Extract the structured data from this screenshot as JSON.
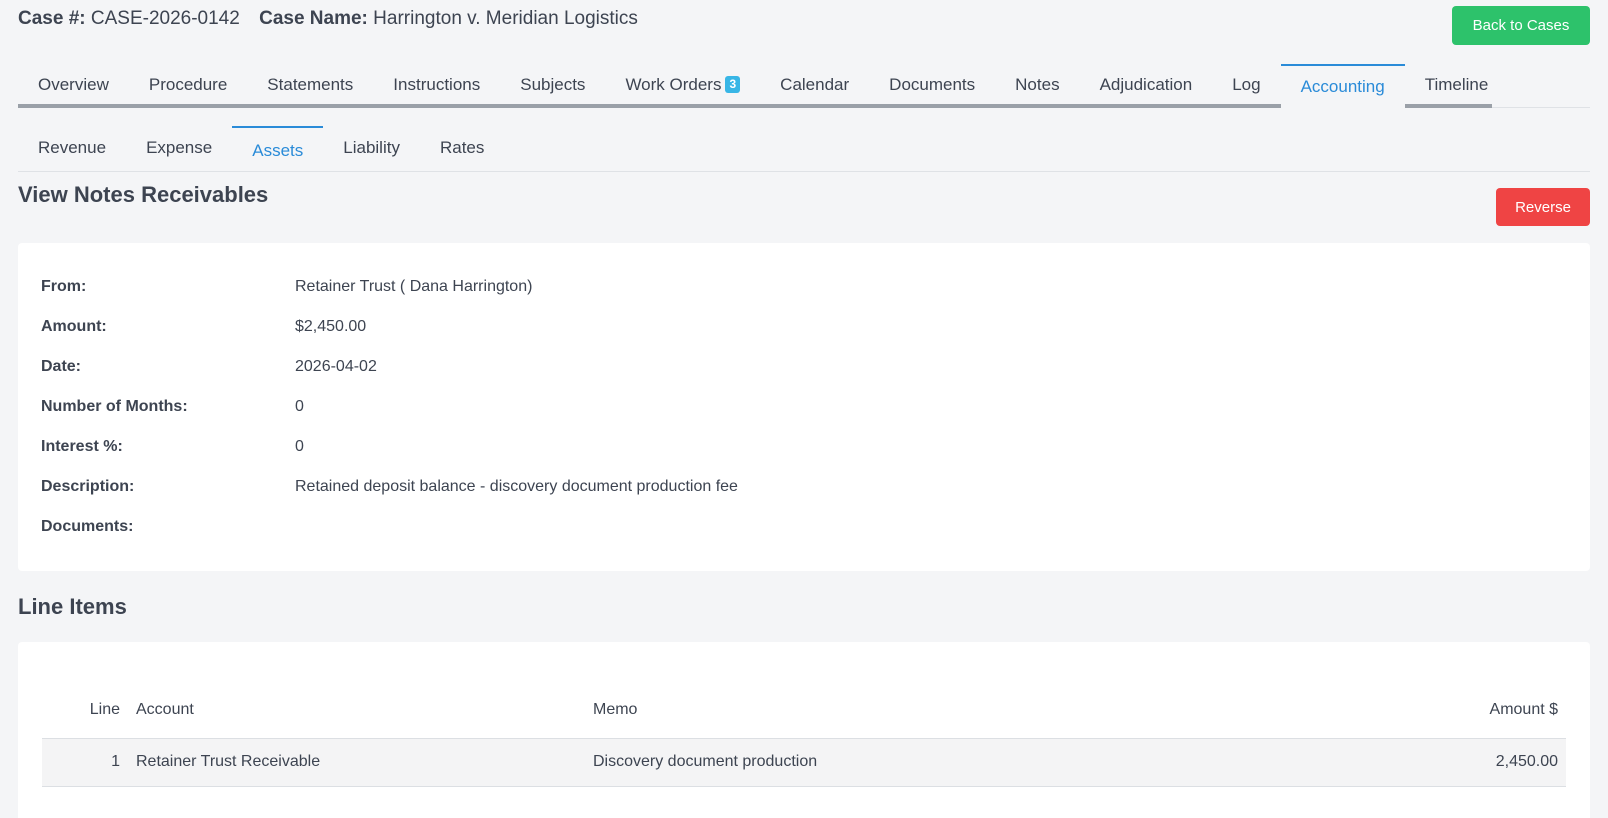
{
  "header": {
    "case_num_label": "Case #:",
    "case_num": "CASE-2026-0142",
    "case_name_label": "Case Name:",
    "case_name": "Harrington v. Meridian Logistics",
    "back_button": "Back to Cases"
  },
  "tabs": [
    {
      "label": "Overview"
    },
    {
      "label": "Procedure"
    },
    {
      "label": "Statements"
    },
    {
      "label": "Instructions"
    },
    {
      "label": "Subjects"
    },
    {
      "label": "Work Orders",
      "badge": "3"
    },
    {
      "label": "Calendar"
    },
    {
      "label": "Documents"
    },
    {
      "label": "Notes"
    },
    {
      "label": "Adjudication"
    },
    {
      "label": "Log"
    },
    {
      "label": "Accounting",
      "active": true
    },
    {
      "label": "Timeline"
    }
  ],
  "subtabs": [
    {
      "label": "Revenue"
    },
    {
      "label": "Expense"
    },
    {
      "label": "Assets",
      "active": true
    },
    {
      "label": "Liability"
    },
    {
      "label": "Rates"
    }
  ],
  "details": {
    "title": "View Notes Receivables",
    "reverse_button": "Reverse",
    "fields": [
      {
        "label": "From:",
        "value": "Retainer Trust ( Dana Harrington)"
      },
      {
        "label": "Amount:",
        "value": "$2,450.00"
      },
      {
        "label": "Date:",
        "value": "2026-04-02"
      },
      {
        "label": "Number of Months:",
        "value": "0"
      },
      {
        "label": "Interest %:",
        "value": "0"
      },
      {
        "label": "Description:",
        "value": "Retained deposit balance - discovery document production fee"
      },
      {
        "label": "Documents:",
        "value": ""
      }
    ]
  },
  "line_items": {
    "title": "Line Items",
    "columns": {
      "line": "Line",
      "account": "Account",
      "memo": "Memo",
      "amount": "Amount $"
    },
    "rows": [
      {
        "line": "1",
        "account": "Retainer Trust Receivable",
        "memo": "Discovery document production",
        "amount": "2,450.00"
      }
    ]
  },
  "colors": {
    "accent": "#2a8bd8",
    "success": "#2dc26b",
    "danger": "#ef4444",
    "badge": "#38b6e6"
  }
}
